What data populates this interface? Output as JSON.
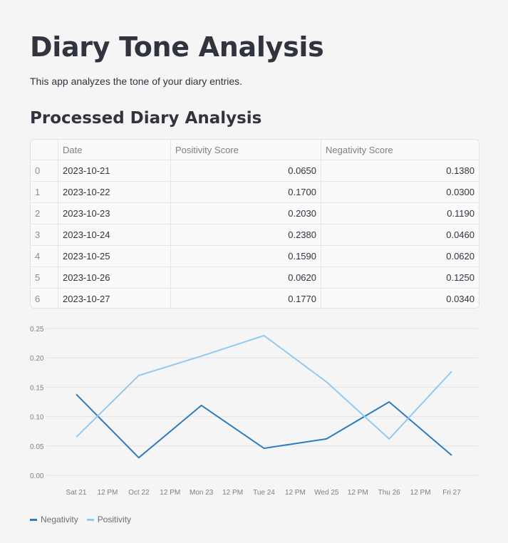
{
  "header": {
    "title": "Diary Tone Analysis",
    "subtitle": "This app analyzes the tone of your diary entries.",
    "section_title": "Processed Diary Analysis"
  },
  "table": {
    "columns": [
      "",
      "Date",
      "Positivity Score",
      "Negativity Score"
    ],
    "rows": [
      {
        "index": "0",
        "date": "2023-10-21",
        "positivity": "0.0650",
        "negativity": "0.1380"
      },
      {
        "index": "1",
        "date": "2023-10-22",
        "positivity": "0.1700",
        "negativity": "0.0300"
      },
      {
        "index": "2",
        "date": "2023-10-23",
        "positivity": "0.2030",
        "negativity": "0.1190"
      },
      {
        "index": "3",
        "date": "2023-10-24",
        "positivity": "0.2380",
        "negativity": "0.0460"
      },
      {
        "index": "4",
        "date": "2023-10-25",
        "positivity": "0.1590",
        "negativity": "0.0620"
      },
      {
        "index": "5",
        "date": "2023-10-26",
        "positivity": "0.0620",
        "negativity": "0.1250"
      },
      {
        "index": "6",
        "date": "2023-10-27",
        "positivity": "0.1770",
        "negativity": "0.0340"
      }
    ]
  },
  "chart_data": {
    "type": "line",
    "x": [
      "2023-10-21",
      "2023-10-22",
      "2023-10-23",
      "2023-10-24",
      "2023-10-25",
      "2023-10-26",
      "2023-10-27"
    ],
    "x_tick_labels": [
      "Sat 21",
      "12 PM",
      "Oct 22",
      "12 PM",
      "Mon 23",
      "12 PM",
      "Tue 24",
      "12 PM",
      "Wed 25",
      "12 PM",
      "Thu 26",
      "12 PM",
      "Fri 27"
    ],
    "y_tick_labels": [
      "0.00",
      "0.05",
      "0.10",
      "0.15",
      "0.20",
      "0.25"
    ],
    "ylim": [
      0,
      0.25
    ],
    "grid": true,
    "legend_position": "bottom-left",
    "series": [
      {
        "name": "Negativity",
        "color": "#2c7bbf",
        "values": [
          0.138,
          0.03,
          0.119,
          0.046,
          0.062,
          0.125,
          0.034
        ]
      },
      {
        "name": "Positivity",
        "color": "#93c9f0",
        "values": [
          0.065,
          0.17,
          0.203,
          0.238,
          0.159,
          0.062,
          0.177
        ]
      }
    ]
  }
}
